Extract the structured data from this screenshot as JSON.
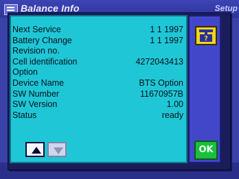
{
  "app": {
    "title": "Balance Info",
    "right_label": "Setup"
  },
  "dialog": {
    "rows": [
      {
        "label": "Next Service",
        "value": "1 1 1997"
      },
      {
        "label": "Battery Change",
        "value": "1 1 1997"
      },
      {
        "label": "Revision no.",
        "value": ""
      },
      {
        "label": "Cell identification",
        "value": "4272043413"
      },
      {
        "label": "Option",
        "value": ""
      },
      {
        "label": "Device Name",
        "value": "BTS Option"
      },
      {
        "label": "SW Number",
        "value": "11670957B"
      },
      {
        "label": "SW Version",
        "value": "1.00"
      },
      {
        "label": "Status",
        "value": "ready"
      }
    ],
    "ok_label": "OK",
    "help_icon": "scale-help-icon",
    "nav_up_icon": "arrow-up-icon",
    "nav_down_icon": "arrow-down-icon"
  },
  "colors": {
    "dialog_main": "#1fc6d6",
    "dialog_side": "#4247c9",
    "ok_button": "#1bbf3c",
    "help_button": "#f2d51a",
    "app_background": "#3a41a8"
  }
}
